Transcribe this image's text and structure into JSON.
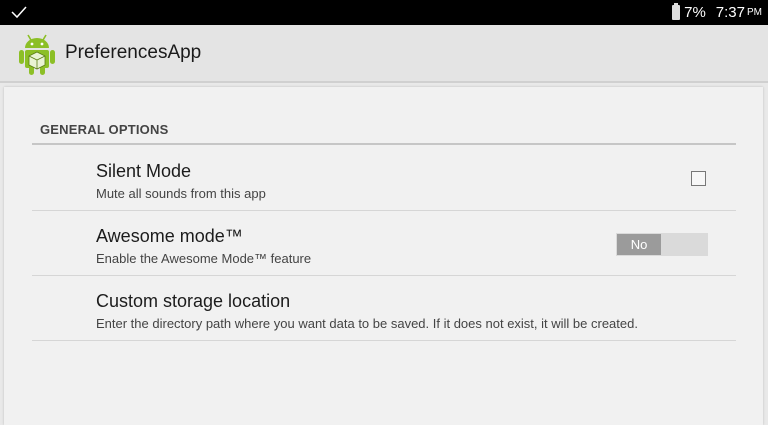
{
  "status_bar": {
    "battery_percent": "7%",
    "time": "7:37",
    "ampm": "PM",
    "left_icon": "check-icon"
  },
  "action_bar": {
    "title": "PreferencesApp",
    "logo_icon": "android-robot-icon"
  },
  "category": {
    "label": "GENERAL OPTIONS"
  },
  "preferences": [
    {
      "title": "Silent Mode",
      "summary": "Mute all sounds from this app",
      "widget": "checkbox",
      "checked": false
    },
    {
      "title": "Awesome mode™",
      "summary": "Enable the Awesome Mode™ feature",
      "widget": "switch",
      "switch_label": "No",
      "on": false
    },
    {
      "title": "Custom storage location",
      "summary": "Enter the directory path where you want data to be saved. If it does not exist, it will be created."
    }
  ],
  "colors": {
    "status_bar": "#000000",
    "action_bar": "#e4e4e4",
    "android_green": "#8cbf26"
  }
}
